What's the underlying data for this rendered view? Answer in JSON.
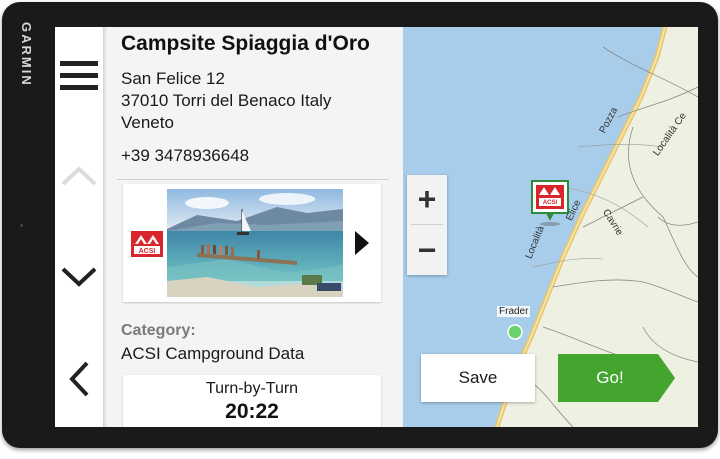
{
  "brand": "GARMIN",
  "poi": {
    "name": "Campsite Spiaggia d'Oro",
    "address": [
      "San Felice 12",
      "37010 Torri del Benaco Italy",
      "Veneto"
    ],
    "phone": "+39 3478936648",
    "logo_text": "ACSI",
    "category_label": "Category:",
    "category_value": "ACSI Campground Data"
  },
  "route": {
    "mode": "Turn-by-Turn",
    "time": "20:22"
  },
  "nav": {
    "menu_icon": "menu-icon",
    "up_icon": "chevron-up-icon",
    "down_icon": "chevron-down-icon",
    "back_icon": "back-icon"
  },
  "zoom": {
    "in_label": "+",
    "out_label": "−"
  },
  "actions": {
    "save_label": "Save",
    "go_label": "Go!"
  },
  "map": {
    "place_label": "Frader",
    "streets": [
      "Pozza",
      "Località Ce",
      "Cavrie"
    ],
    "colors": {
      "water": "#a8cdea",
      "land": "#eef1e1",
      "road": "#e6c56a"
    }
  },
  "colors": {
    "go": "#43a52e",
    "bezel": "#1a1a1a",
    "acsi_red": "#d8262c"
  }
}
